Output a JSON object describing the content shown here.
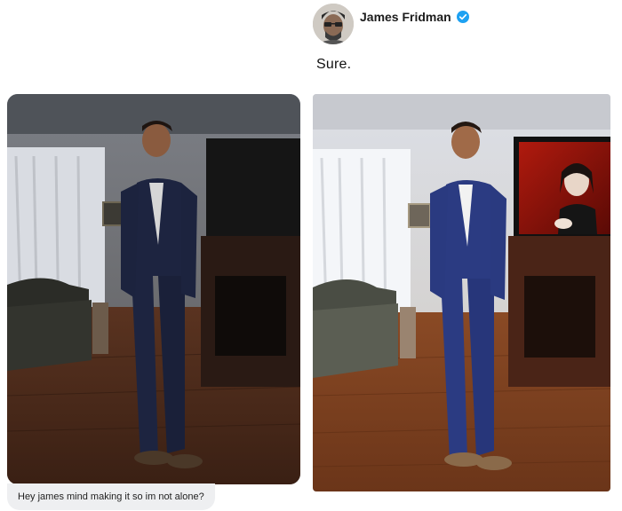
{
  "reply": {
    "author_name": "James Fridman",
    "verified_icon": "verified-badge-icon",
    "text": "Sure."
  },
  "request": {
    "message_text": "Hey james mind making it so im not alone?"
  },
  "colors": {
    "verified_blue": "#1da1f2",
    "bubble_bg": "#eeeff1"
  }
}
